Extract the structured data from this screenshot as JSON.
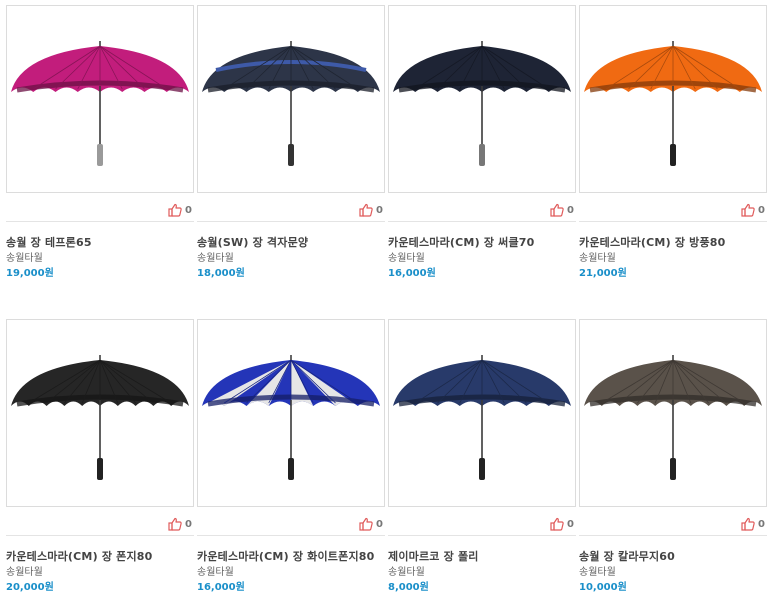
{
  "products": [
    {
      "name": "송월 장 테프론65",
      "brand": "송월타월",
      "price": "19,000원",
      "likes": "0",
      "canopy": "#c21d7c",
      "band": "",
      "panels": "",
      "handle": "#9a9a9a",
      "ribs": 8
    },
    {
      "name": "송월(SW) 장 격자문양",
      "brand": "송월타월",
      "price": "18,000원",
      "likes": "0",
      "canopy": "#2d3548",
      "band": "#3e5aa8",
      "panels": "",
      "handle": "#333333",
      "ribs": 8
    },
    {
      "name": "카운테스마라(CM) 장 써클70",
      "brand": "송월타월",
      "price": "16,000원",
      "likes": "0",
      "canopy": "#1e2435",
      "band": "",
      "panels": "",
      "handle": "#777777",
      "ribs": 8
    },
    {
      "name": "카운테스마라(CM) 장 방풍80",
      "brand": "송월타월",
      "price": "21,000원",
      "likes": "0",
      "canopy": "#f06a12",
      "band": "",
      "panels": "",
      "handle": "#222222",
      "ribs": 8
    },
    {
      "name": "카운테스마라(CM) 장 폰지80",
      "brand": "송월타월",
      "price": "20,000원",
      "likes": "0",
      "canopy": "#262626",
      "band": "",
      "panels": "",
      "handle": "#222222",
      "ribs": 10
    },
    {
      "name": "카운테스마라(CM) 장 화이트폰지80",
      "brand": "송월타월",
      "price": "16,000원",
      "likes": "0",
      "canopy": "#2435b8",
      "band": "",
      "panels": "#e6e6e6",
      "handle": "#222222",
      "ribs": 8
    },
    {
      "name": "제이마르코 장 폴리",
      "brand": "송월타월",
      "price": "8,000원",
      "likes": "0",
      "canopy": "#283a6a",
      "band": "",
      "panels": "",
      "handle": "#222222",
      "ribs": 8
    },
    {
      "name": "송월 장 칼라무지60",
      "brand": "송월타월",
      "price": "10,000원",
      "likes": "0",
      "canopy": "#5a524a",
      "band": "",
      "panels": "",
      "handle": "#222222",
      "ribs": 10
    }
  ]
}
